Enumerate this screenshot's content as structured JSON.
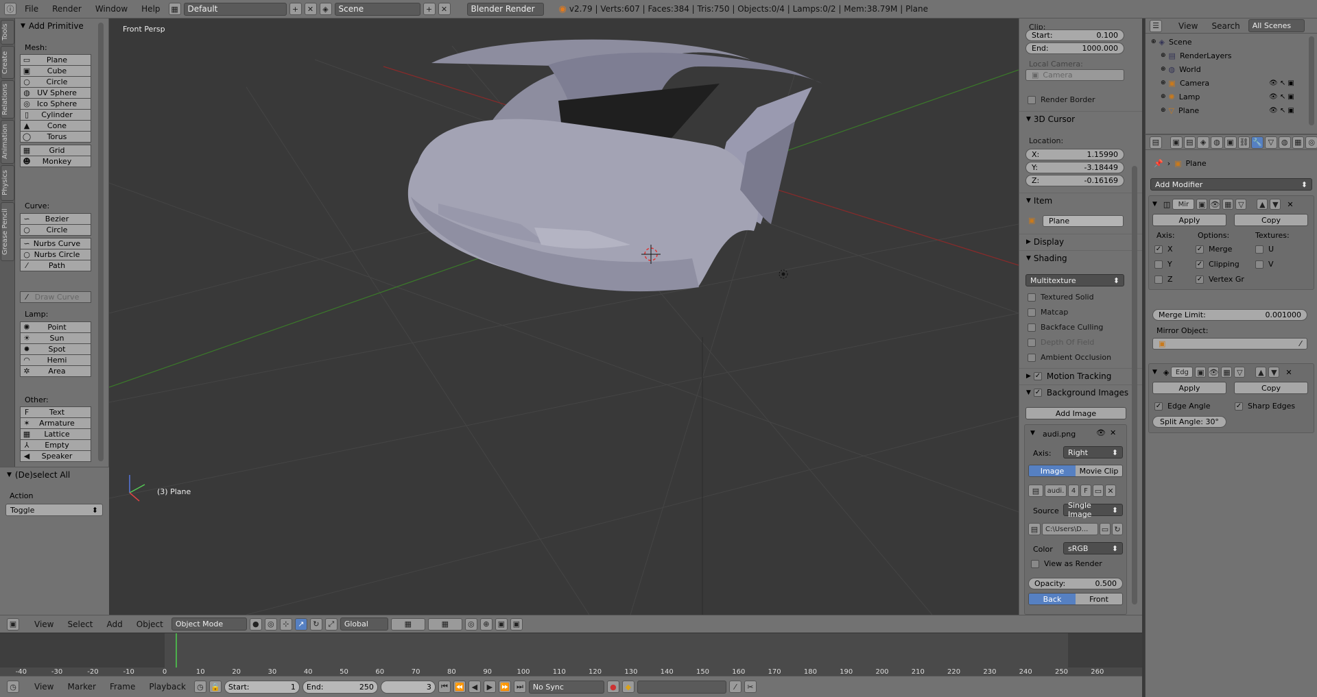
{
  "topbar": {
    "menus": [
      "File",
      "Render",
      "Window",
      "Help"
    ],
    "layout": "Default",
    "scene": "Scene",
    "engine": "Blender Render",
    "stats": "v2.79 | Verts:607 | Faces:384 | Tris:750 | Objects:0/4 | Lamps:0/2 | Mem:38.79M | Plane"
  },
  "toolshelf": {
    "tabs": [
      "Tools",
      "Create",
      "Relations",
      "Animation",
      "Physics",
      "Grease Pencil"
    ],
    "panel_title": "Add Primitive",
    "mesh_label": "Mesh:",
    "mesh": [
      {
        "label": "Plane",
        "icon": "plane-icon",
        "glyph": "▭"
      },
      {
        "label": "Cube",
        "icon": "cube-icon",
        "glyph": "▣"
      },
      {
        "label": "Circle",
        "icon": "circle-icon",
        "glyph": "○"
      },
      {
        "label": "UV Sphere",
        "icon": "uv-sphere-icon",
        "glyph": "◍"
      },
      {
        "label": "Ico Sphere",
        "icon": "ico-sphere-icon",
        "glyph": "◎"
      },
      {
        "label": "Cylinder",
        "icon": "cylinder-icon",
        "glyph": "▯"
      },
      {
        "label": "Cone",
        "icon": "cone-icon",
        "glyph": "▲"
      },
      {
        "label": "Torus",
        "icon": "torus-icon",
        "glyph": "◯"
      },
      {
        "label": "Grid",
        "icon": "grid-icon",
        "glyph": "▦"
      },
      {
        "label": "Monkey",
        "icon": "monkey-icon",
        "glyph": "☻"
      }
    ],
    "curve_label": "Curve:",
    "curve": [
      {
        "label": "Bezier",
        "icon": "bezier-icon",
        "glyph": "∽"
      },
      {
        "label": "Circle",
        "icon": "curve-circle-icon",
        "glyph": "○"
      },
      {
        "label": "Nurbs Curve",
        "icon": "nurbs-curve-icon",
        "glyph": "∽"
      },
      {
        "label": "Nurbs Circle",
        "icon": "nurbs-circle-icon",
        "glyph": "○"
      },
      {
        "label": "Path",
        "icon": "path-icon",
        "glyph": "⁄"
      }
    ],
    "draw_curve": "Draw Curve",
    "lamp_label": "Lamp:",
    "lamp": [
      {
        "label": "Point",
        "icon": "point-lamp-icon",
        "glyph": "✺"
      },
      {
        "label": "Sun",
        "icon": "sun-lamp-icon",
        "glyph": "☀"
      },
      {
        "label": "Spot",
        "icon": "spot-lamp-icon",
        "glyph": "✹"
      },
      {
        "label": "Hemi",
        "icon": "hemi-lamp-icon",
        "glyph": "◠"
      },
      {
        "label": "Area",
        "icon": "area-lamp-icon",
        "glyph": "✲"
      }
    ],
    "other_label": "Other:",
    "other": [
      {
        "label": "Text",
        "icon": "text-icon",
        "glyph": "F"
      },
      {
        "label": "Armature",
        "icon": "armature-icon",
        "glyph": "✶"
      },
      {
        "label": "Lattice",
        "icon": "lattice-icon",
        "glyph": "▦"
      },
      {
        "label": "Empty",
        "icon": "empty-icon",
        "glyph": "⅄"
      },
      {
        "label": "Speaker",
        "icon": "speaker-icon",
        "glyph": "◀"
      }
    ]
  },
  "operator_panel": {
    "title": "(De)select All",
    "action_label": "Action",
    "action_value": "Toggle"
  },
  "viewport": {
    "view_name": "Front Persp",
    "object_label": "(3) Plane"
  },
  "npanel": {
    "clip_label": "Clip:",
    "clip_start_label": "Start:",
    "clip_start": "0.100",
    "clip_end_label": "End:",
    "clip_end": "1000.000",
    "local_camera_label": "Local Camera:",
    "local_camera": "Camera",
    "render_border": "Render Border",
    "cursor_title": "3D Cursor",
    "location_label": "Location:",
    "x_label": "X:",
    "x": "1.15990",
    "y_label": "Y:",
    "y": "-3.18449",
    "z_label": "Z:",
    "z": "-0.16169",
    "item_title": "Item",
    "item_name": "Plane",
    "display_title": "Display",
    "shading_title": "Shading",
    "shading_mode": "Multitexture",
    "shading_opts": [
      "Textured Solid",
      "Matcap",
      "Backface Culling",
      "Depth Of Field",
      "Ambient Occlusion"
    ],
    "motion_tracking": "Motion Tracking",
    "bg_images": "Background Images",
    "add_image": "Add Image",
    "image_name": "audi.png",
    "axis_label": "Axis:",
    "axis_value": "Right",
    "tab_image": "Image",
    "tab_movie": "Movie Clip",
    "img_short": "audi.",
    "img_users": "4",
    "img_f": "F",
    "source_label": "Source",
    "source_value": "Single Image",
    "path_value": "C:\\Users\\D...",
    "color_label": "Color",
    "color_value": "sRGB",
    "view_as_render": "View as Render",
    "opacity_label": "Opacity:",
    "opacity": "0.500",
    "back": "Back",
    "front": "Front"
  },
  "outliner": {
    "menus": [
      "View",
      "Search"
    ],
    "scope": "All Scenes",
    "rows": [
      {
        "label": "Scene",
        "icon": "scene-icon",
        "glyph": "◈",
        "indent": 0
      },
      {
        "label": "RenderLayers",
        "icon": "render-layers-icon",
        "glyph": "▤",
        "indent": 1
      },
      {
        "label": "World",
        "icon": "world-icon",
        "glyph": "◍",
        "indent": 1
      },
      {
        "label": "Camera",
        "icon": "camera-icon",
        "glyph": "▣",
        "indent": 1
      },
      {
        "label": "Lamp",
        "icon": "lamp-icon",
        "glyph": "✺",
        "indent": 1
      },
      {
        "label": "Plane",
        "icon": "plane-object-icon",
        "glyph": "▽",
        "indent": 1
      }
    ]
  },
  "properties": {
    "object_name": "Plane",
    "add_modifier": "Add Modifier",
    "mirror": {
      "name": "Mir",
      "apply": "Apply",
      "copy": "Copy",
      "axis_label": "Axis:",
      "options_label": "Options:",
      "textures_label": "Textures:",
      "x": "X",
      "y": "Y",
      "z": "Z",
      "merge": "Merge",
      "clipping": "Clipping",
      "vertex_gr": "Vertex Gr",
      "u": "U",
      "v": "V",
      "merge_limit_label": "Merge Limit:",
      "merge_limit": "0.001000",
      "mirror_object_label": "Mirror Object:"
    },
    "edge": {
      "name": "Edg",
      "apply": "Apply",
      "copy": "Copy",
      "edge_angle": "Edge Angle",
      "sharp_edges": "Sharp Edges",
      "split_angle": "Split Angle: 30°"
    }
  },
  "vheader": {
    "menus": [
      "View",
      "Select",
      "Add",
      "Object"
    ],
    "mode": "Object Mode",
    "orientation": "Global"
  },
  "timeline": {
    "ticks": [
      "-40",
      "-30",
      "-20",
      "-10",
      "0",
      "10",
      "20",
      "30",
      "40",
      "50",
      "60",
      "70",
      "80",
      "90",
      "100",
      "110",
      "120",
      "130",
      "140",
      "150",
      "160",
      "170",
      "180",
      "190",
      "200",
      "210",
      "220",
      "230",
      "240",
      "250",
      "260"
    ],
    "current_frame": 3,
    "menus": [
      "View",
      "Marker",
      "Frame",
      "Playback"
    ],
    "start_label": "Start:",
    "start": "1",
    "end_label": "End:",
    "end": "250",
    "frame": "3",
    "sync": "No Sync"
  }
}
